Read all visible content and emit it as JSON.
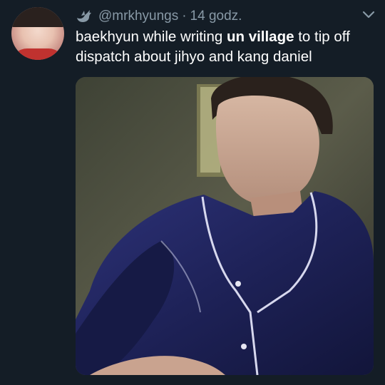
{
  "tweet": {
    "handle": "@mrkhyungs",
    "separator": "·",
    "time": "14 godz.",
    "text_part1": "baekhyun while writing ",
    "text_bold": "un village",
    "text_part2": " to tip off dispatch about jihyo and kang daniel"
  },
  "icons": {
    "badge": "bird-icon",
    "menu": "chevron-down-icon"
  },
  "colors": {
    "background": "#141d26",
    "muted_text": "#8899a6",
    "text": "#ffffff"
  }
}
